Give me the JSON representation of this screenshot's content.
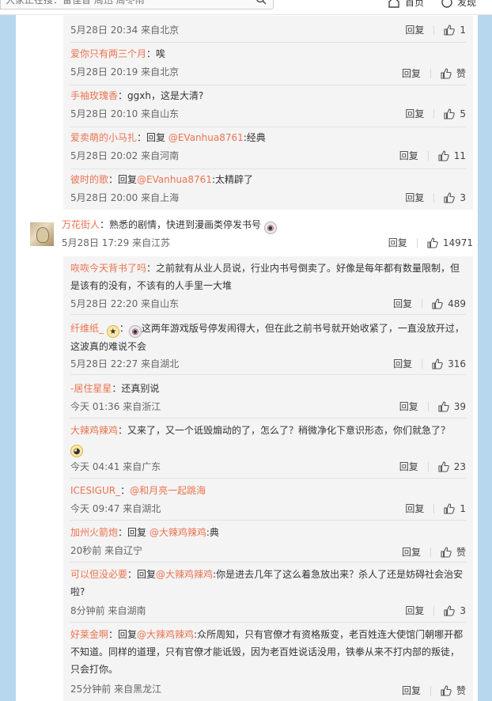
{
  "topbar": {
    "search_placeholder": "大家正在搜：雷佳音 周迅 周冬雨",
    "nav": [
      {
        "icon": "home-icon",
        "label": "首页"
      },
      {
        "icon": "discover-icon",
        "label": "发现"
      }
    ]
  },
  "actions": {
    "reply_label": "回复",
    "like_fallback": "赞"
  },
  "sub_replies_a": [
    {
      "user": "",
      "text": "",
      "mention": "",
      "after": "",
      "time": "5月28日 20:34",
      "loc": "来自北京",
      "likes": "1"
    },
    {
      "user": "爱你只有两三个月",
      "text": "：唉",
      "time": "5月28日 20:19",
      "loc": "来自北京",
      "likes": "赞"
    },
    {
      "user": "手袖玫瑰香",
      "text": "：ggxh，这是大清?",
      "time": "5月28日 20:10",
      "loc": "来自山东",
      "likes": "5"
    },
    {
      "user": "爱卖萌的小马扎",
      "text": "：回复 ",
      "mention": "@EVanhua8761",
      "after": ":经典",
      "time": "5月28日 20:02",
      "loc": "来自河南",
      "likes": "11"
    },
    {
      "user": "彼时的歌",
      "text": "：回复",
      "mention": "@EVanhua8761",
      "after": ":太精辟了",
      "time": "5月28日 20:00",
      "loc": "来自上海",
      "likes": "3"
    }
  ],
  "top_comment": {
    "user": "万花街人",
    "text": "：熟悉的剧情，快进到漫画类停发书号",
    "time": "5月28日 17:29",
    "loc": "来自江苏",
    "likes": "14971"
  },
  "sub_replies_b": [
    {
      "user": "咴咴今天背书了吗",
      "text": "：之前就有从业人员说，行业内书号倒卖了。好像是每年都有数量限制，但是该有的没有，不该有的人手里一大堆",
      "time": "5月28日 22:20",
      "loc": "来自山东",
      "likes": "489"
    },
    {
      "user": "纤维纸_",
      "text": "这两年游戏版号停发闹得大，但在此之前书号就开始收紧了，一直没放开过，这波真的难说不会",
      "time": "5月28日 22:27",
      "loc": "来自湖北",
      "likes": "316"
    },
    {
      "user": "-居住星星",
      "text": "：还真别说",
      "time": "今天 01:36",
      "loc": "来自浙江",
      "likes": "39"
    },
    {
      "user": "大辣鸡辣鸡",
      "text": "：又来了，又一个诋毁煽动的了，怎么了？稍微净化下意识形态，你们就急了？",
      "time": "今天 04:41",
      "loc": "来自广东",
      "likes": "23"
    },
    {
      "user": "ICESIGUR_",
      "text": "：",
      "mention": "@和月亮一起跳海",
      "time": "今天 09:47",
      "loc": "来自湖北",
      "likes": "1"
    },
    {
      "user": "加州火箭炮",
      "text": "：回复 ",
      "mention": "@大辣鸡辣鸡",
      "after": ":典",
      "time": "20秒前",
      "loc": "来自辽宁",
      "likes": "赞"
    },
    {
      "user": "可以但没必要",
      "text": "：回复",
      "mention": "@大辣鸡辣鸡",
      "after": ":你是进去几年了这么着急放出来？杀人了还是妨碍社会治安啦?",
      "time": "8分钟前",
      "loc": "来自湖南",
      "likes": "3"
    },
    {
      "user": "好莱金啊",
      "text": "：回复",
      "mention": "@大辣鸡辣鸡",
      "after": ":众所周知，只有官僚才有资格叛变，老百姓连大使馆门朝哪开都不知道。同样的道理，只有官僚才能诋毁，因为老百姓说话没用，铁拳从来不打内部的叛徒，只会打你。",
      "time": "25分钟前",
      "loc": "来自黑龙江",
      "likes": "赞"
    }
  ]
}
